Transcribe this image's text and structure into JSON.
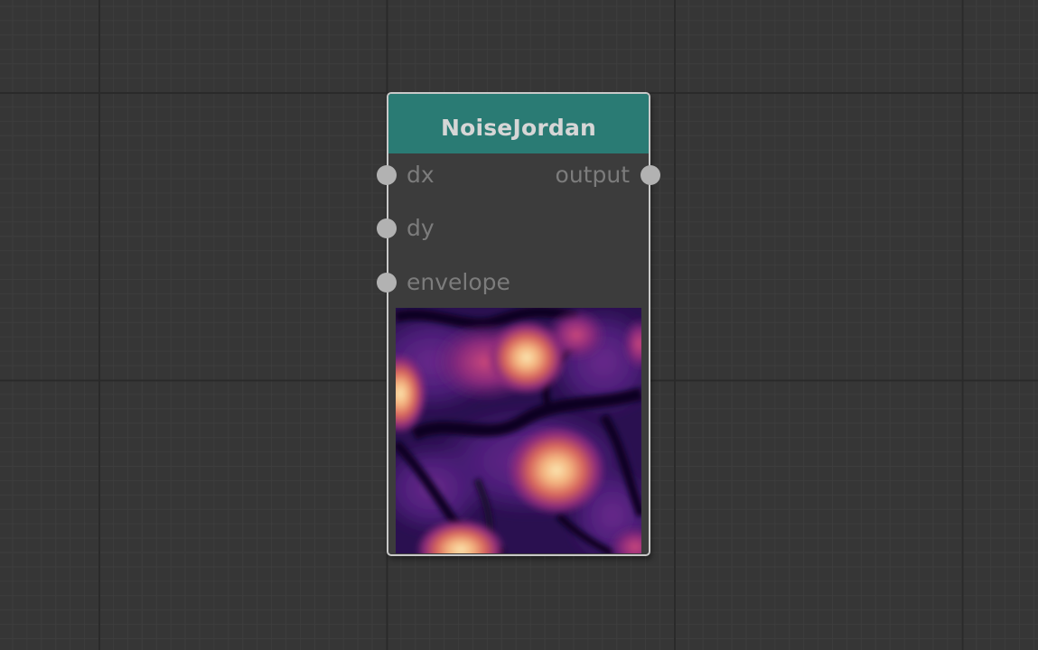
{
  "node": {
    "title": "NoiseJordan",
    "inputs": [
      {
        "label": "dx"
      },
      {
        "label": "dy"
      },
      {
        "label": "envelope"
      }
    ],
    "outputs": [
      {
        "label": "output"
      }
    ],
    "preview": {
      "colormap": "magma",
      "colors": {
        "dark": "#0d0620",
        "purple": "#4b1d78",
        "magenta": "#9a2f7a",
        "orange": "#e0744c",
        "light": "#fbe6b0"
      }
    },
    "header_color": "#2a7b74"
  }
}
